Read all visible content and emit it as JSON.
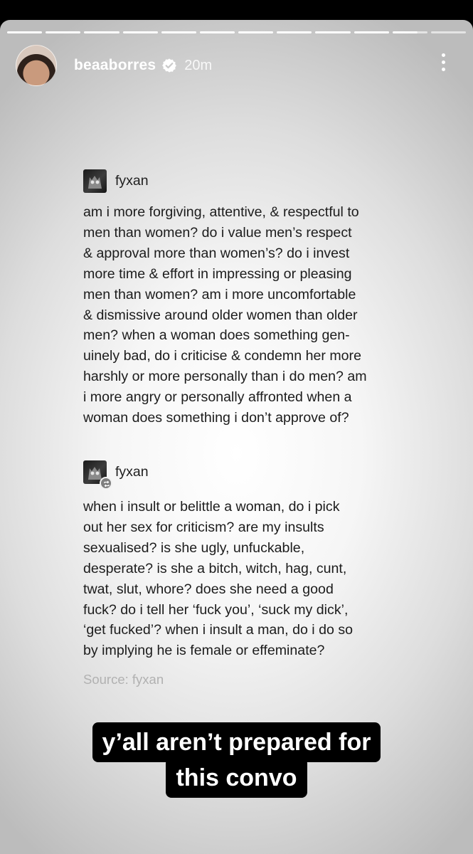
{
  "story": {
    "progress": {
      "segments": 12,
      "completed": 10
    },
    "user": {
      "username": "beaaborres",
      "verified": true,
      "time_ago": "20m"
    },
    "menu_icon": "more-vertical-icon"
  },
  "posts": [
    {
      "author": "fyxan",
      "reblogged": false,
      "lines": [
        "am i more forgiving, attentive, & respectful to",
        "men than women?  do i value men’s respect",
        "& approval more than women’s?  do i invest",
        "more time & effort in impressing or pleasing",
        "men than women?  am i more uncomfortable",
        "& dismissive around older women than older",
        "men?  when a woman does something gen-",
        "uinely bad, do i criticise & condemn her more",
        "harshly or more personally than i do men?  am",
        "i more angry or personally affronted when a",
        "woman does something i don’t approve of?"
      ]
    },
    {
      "author": "fyxan",
      "reblogged": true,
      "lines": [
        "when i insult or belittle a woman, do i pick",
        "out her sex for criticism?  are my insults",
        "sexualised?  is she ugly, unfuckable,",
        "desperate?  is she a bitch, witch, hag, cunt,",
        "twat, slut, whore?  does she need a good",
        "fuck?  do i tell her ‘fuck you’, ‘suck my dick’,",
        "‘get fucked’?  when i insult a man, do i do so",
        "by implying he is female or effeminate?"
      ]
    }
  ],
  "source": "Source: fyxan",
  "caption": [
    "y’all aren’t prepared for",
    "this convo"
  ],
  "colors": {
    "background": "#000000",
    "verified_badge": "#ffffff",
    "caption_bg": "#000000",
    "caption_text": "#ffffff"
  }
}
